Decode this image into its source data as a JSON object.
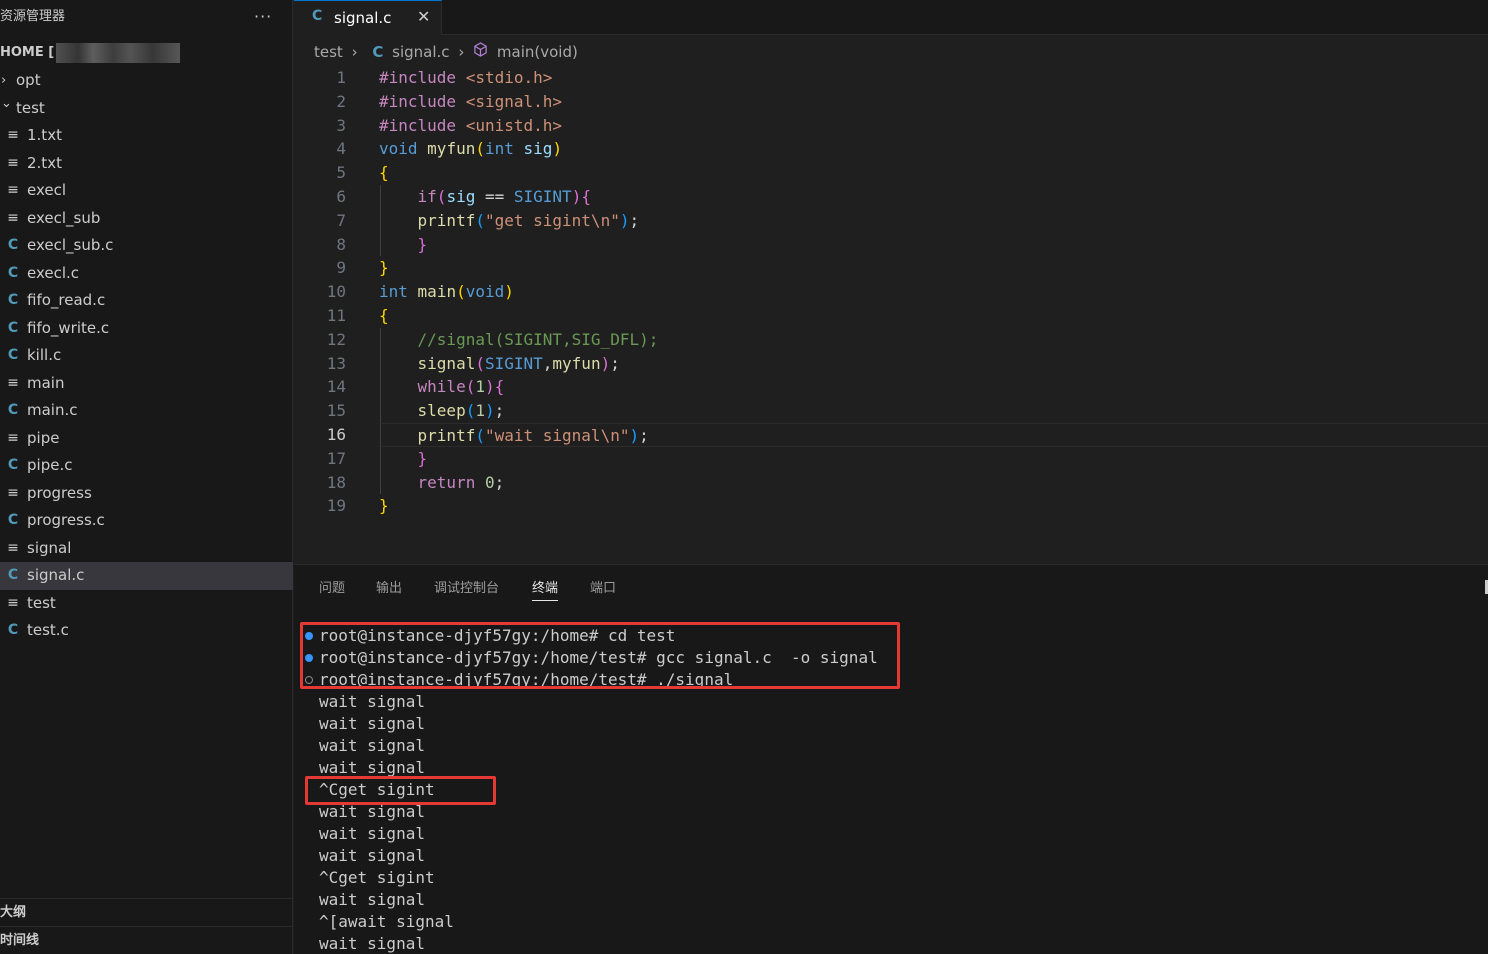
{
  "sidebar": {
    "title": "资源管理器",
    "more_icon": "···",
    "home_label": "HOME [",
    "tree": [
      {
        "type": "folder",
        "label": "opt",
        "expanded": false
      },
      {
        "type": "folder",
        "label": "test",
        "expanded": true
      },
      {
        "type": "text",
        "label": "1.txt"
      },
      {
        "type": "text",
        "label": "2.txt"
      },
      {
        "type": "text",
        "label": "execl"
      },
      {
        "type": "text",
        "label": "execl_sub"
      },
      {
        "type": "c",
        "label": "execl_sub.c"
      },
      {
        "type": "c",
        "label": "execl.c"
      },
      {
        "type": "c",
        "label": "fifo_read.c"
      },
      {
        "type": "c",
        "label": "fifo_write.c"
      },
      {
        "type": "c",
        "label": "kill.c"
      },
      {
        "type": "text",
        "label": "main"
      },
      {
        "type": "c",
        "label": "main.c"
      },
      {
        "type": "text",
        "label": "pipe"
      },
      {
        "type": "c",
        "label": "pipe.c"
      },
      {
        "type": "text",
        "label": "progress"
      },
      {
        "type": "c",
        "label": "progress.c"
      },
      {
        "type": "text",
        "label": "signal"
      },
      {
        "type": "c",
        "label": "signal.c",
        "selected": true
      },
      {
        "type": "text",
        "label": "test"
      },
      {
        "type": "c",
        "label": "test.c"
      }
    ],
    "outline_label": "大纲",
    "timeline_label": "时间线"
  },
  "editor": {
    "tab_label": "signal.c",
    "tab_icon": "C",
    "close_icon": "✕",
    "breadcrumb": {
      "folder": "test",
      "file_icon": "C",
      "file": "signal.c",
      "symbol": "main(void)"
    },
    "current_line": 16,
    "line_numbers": [
      "1",
      "2",
      "3",
      "4",
      "5",
      "6",
      "7",
      "8",
      "9",
      "10",
      "11",
      "12",
      "13",
      "14",
      "15",
      "16",
      "17",
      "18",
      "19"
    ]
  },
  "panel": {
    "tabs": [
      "问题",
      "输出",
      "调试控制台",
      "终端",
      "端口"
    ],
    "active_tab": "终端",
    "terminal_lines": [
      "root@instance-djyf57gy:/home# cd test",
      "root@instance-djyf57gy:/home/test# gcc signal.c  -o signal",
      "root@instance-djyf57gy:/home/test# ./signal",
      "wait signal",
      "wait signal",
      "wait signal",
      "wait signal",
      "^Cget sigint",
      "wait signal",
      "wait signal",
      "wait signal",
      "^Cget sigint",
      "wait signal",
      "^[await signal",
      "wait signal"
    ]
  },
  "colors": {
    "accent": "#0078d4",
    "highlight_box": "#e53935",
    "c_icon": "#519aba"
  }
}
